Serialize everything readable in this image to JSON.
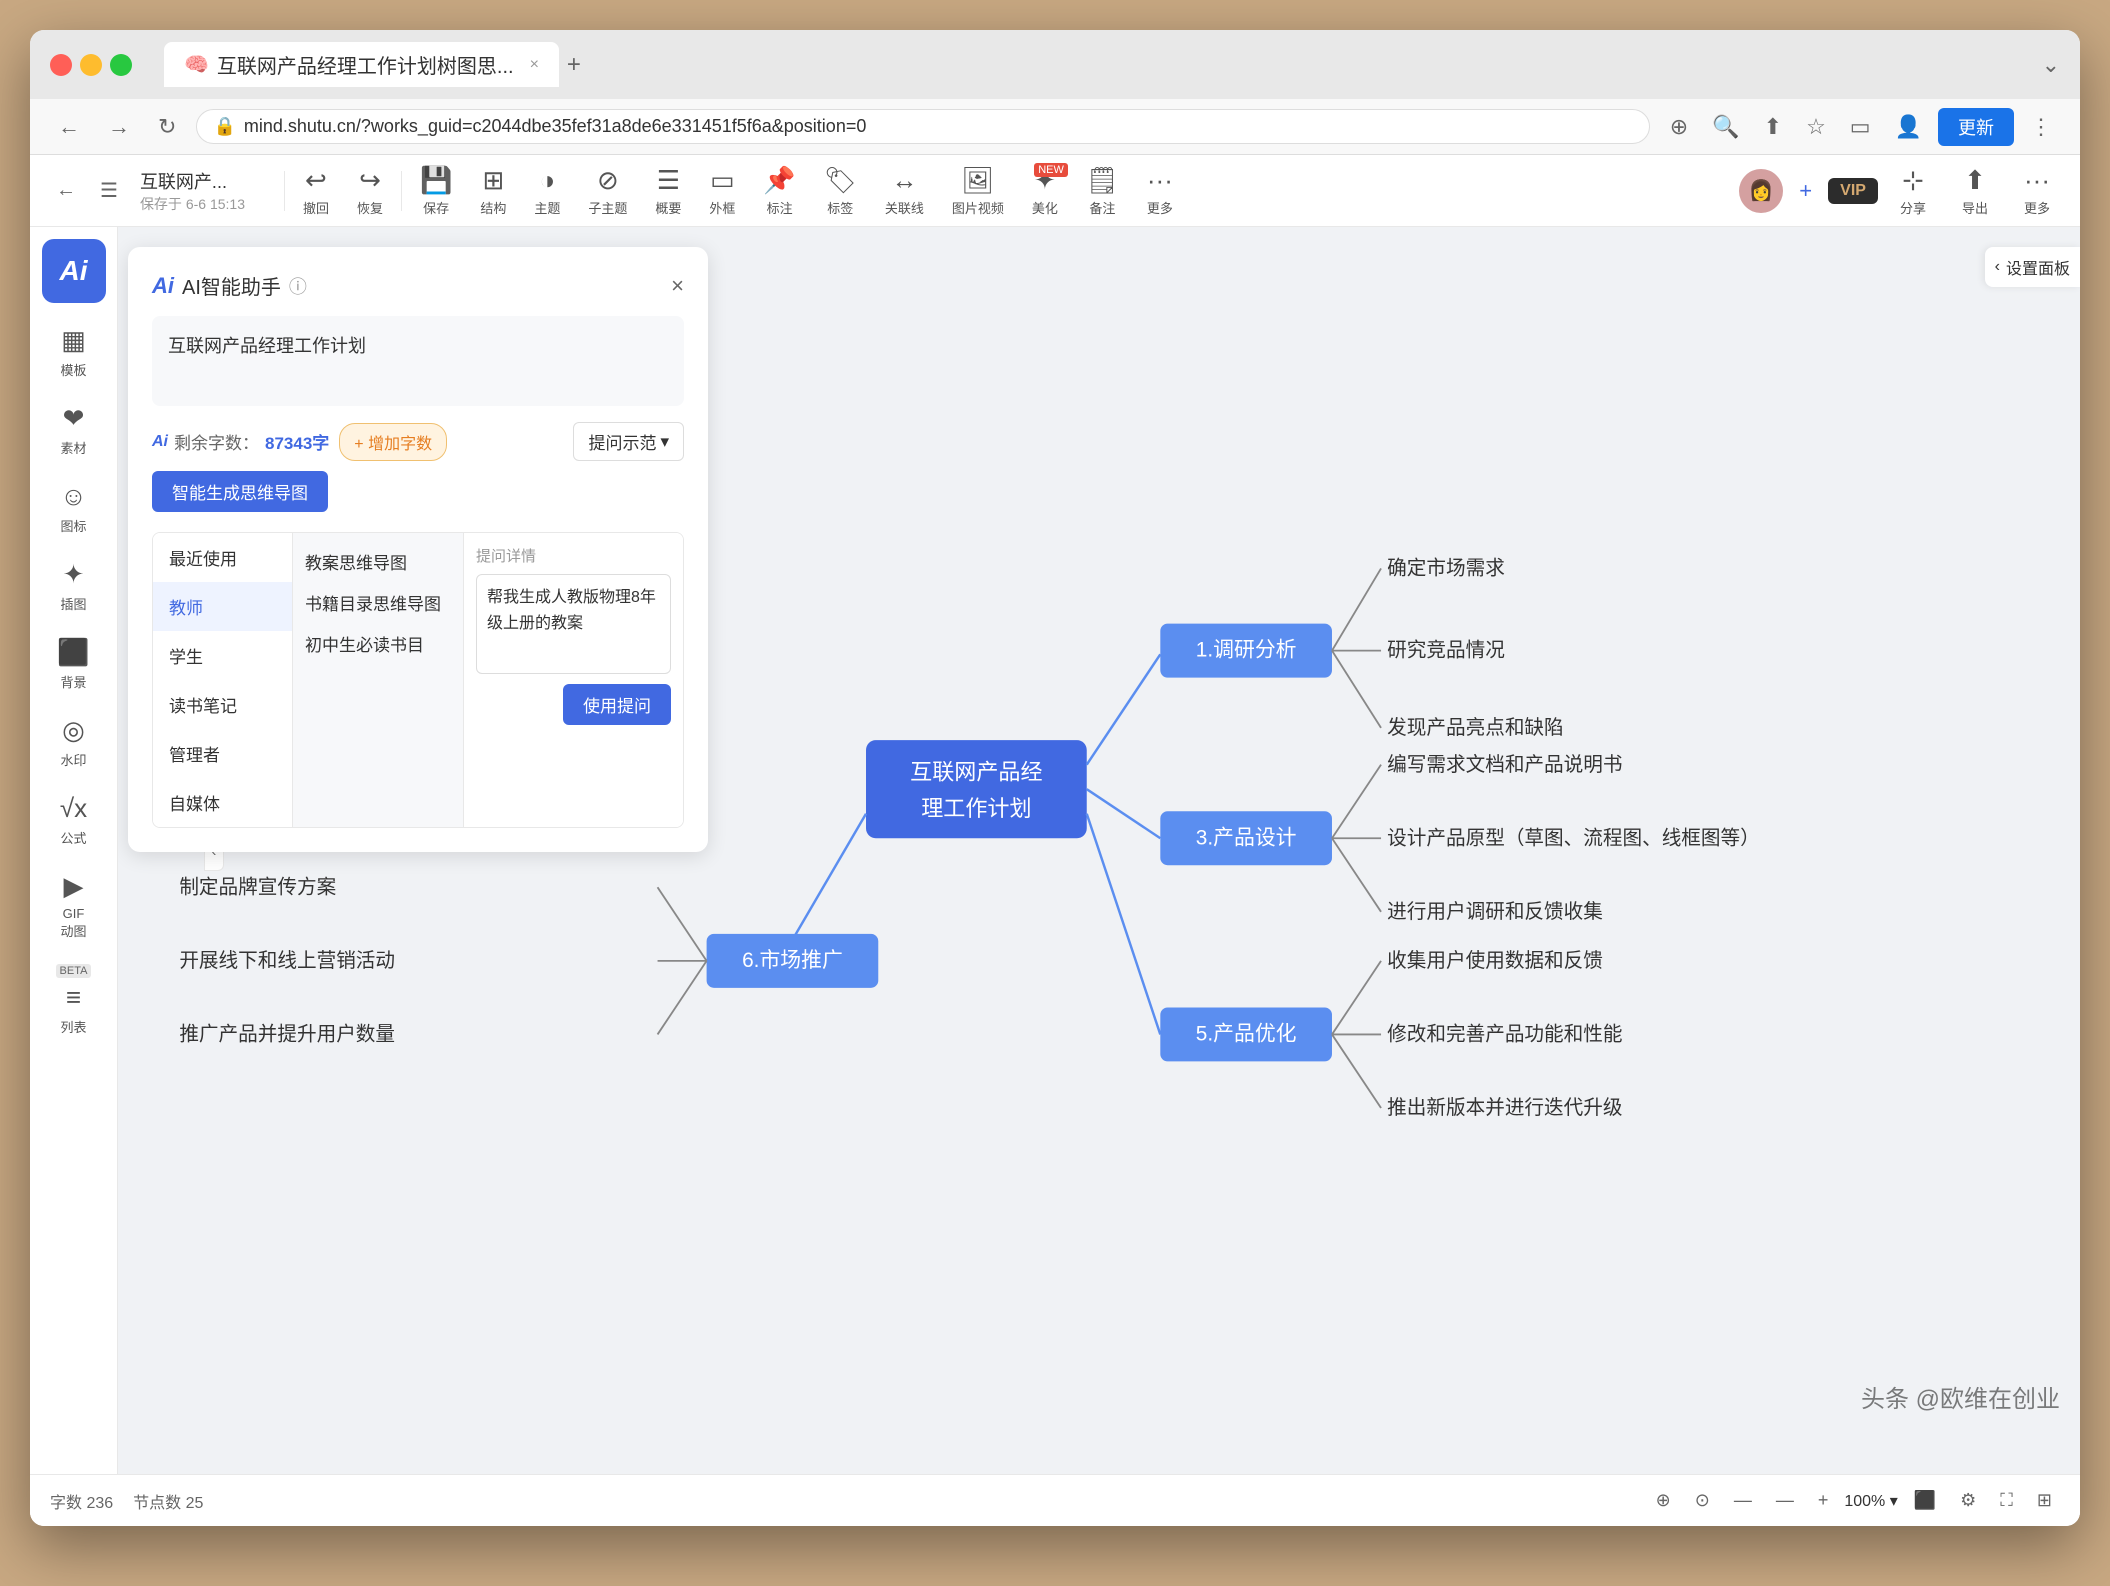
{
  "browser": {
    "url": "mind.shutu.cn/?works_guid=c2044dbe35fef31a8de6e331451f5f6a&position=0",
    "tab_title": "互联网产品经理工作计划树图思...",
    "update_btn": "更新"
  },
  "toolbar": {
    "title": "互联网产...",
    "save_status": "保存于 6-6 15:13",
    "undo": "撤回",
    "redo": "恢复",
    "save": "保存",
    "structure": "结构",
    "theme": "主题",
    "sub_theme": "子主题",
    "summary": "概要",
    "frame": "外框",
    "mark": "标注",
    "tag": "标签",
    "relate": "关联线",
    "media": "图片视频",
    "beautify": "美化",
    "backup": "备注",
    "more": "更多",
    "share": "分享",
    "export": "导出",
    "more2": "更多",
    "vip": "VIP"
  },
  "sidebar": {
    "ai_text": "Ai",
    "items": [
      {
        "label": "模板",
        "icon": "▦"
      },
      {
        "label": "素材",
        "icon": "❤"
      },
      {
        "label": "图标",
        "icon": "☺"
      },
      {
        "label": "插图",
        "icon": "✦"
      },
      {
        "label": "背景",
        "icon": "⬛"
      },
      {
        "label": "水印",
        "icon": "◎"
      },
      {
        "label": "公式",
        "icon": "√"
      },
      {
        "label": "GIF\n动图",
        "icon": "▶"
      },
      {
        "label": "列表",
        "icon": "≡",
        "badge": "BETA"
      }
    ]
  },
  "ai_panel": {
    "logo": "Ai",
    "title": "AI智能助手",
    "close": "×",
    "input_text": "互联网产品经理工作计划",
    "remaining_label": "剩余字数：",
    "remaining_count": "87343字",
    "add_btn": "+ 增加字数",
    "prompt_btn": "提问示范",
    "generate_btn": "智能生成思维导图",
    "categories": [
      {
        "label": "最近使用"
      },
      {
        "label": "教师",
        "active": true
      },
      {
        "label": "学生"
      },
      {
        "label": "读书笔记"
      },
      {
        "label": "管理者"
      },
      {
        "label": "自媒体"
      }
    ],
    "templates": [
      {
        "label": "教案思维导图"
      },
      {
        "label": "书籍目录思维导图"
      },
      {
        "label": "初中生必读书目"
      }
    ],
    "prompt_detail_title": "提问详情",
    "prompt_detail_text": "帮我生成人教版物理8年级上册的教案",
    "use_prompt_btn": "使用提问"
  },
  "mind_map": {
    "central": "互联网产品经\n理工作计划",
    "branches": [
      {
        "label": "1.调研分析",
        "leaves": [
          "确定市场需求",
          "研究竞品情况",
          "发现产品亮点和缺陷"
        ]
      },
      {
        "label": "3.产品设计",
        "leaves": [
          "编写需求文档和产品说明书",
          "设计产品原型（草图、流程图、线框图等）",
          "进行用户调研和反馈收集"
        ]
      },
      {
        "label": "5.产品优化",
        "leaves": [
          "收集用户使用数据和反馈",
          "修改和完善产品功能和性能",
          "推出新版本并进行迭代升级"
        ]
      },
      {
        "label": "6.市场推广",
        "leaves": [
          "制定品牌宣传方案",
          "开展线下和线上营销活动",
          "推广产品并提升用户数量"
        ]
      }
    ]
  },
  "status_bar": {
    "char_count_label": "字数",
    "char_count": "236",
    "node_count_label": "节点数",
    "node_count": "25",
    "zoom": "100%"
  },
  "right_panel": {
    "toggle_label": "设置面板"
  }
}
